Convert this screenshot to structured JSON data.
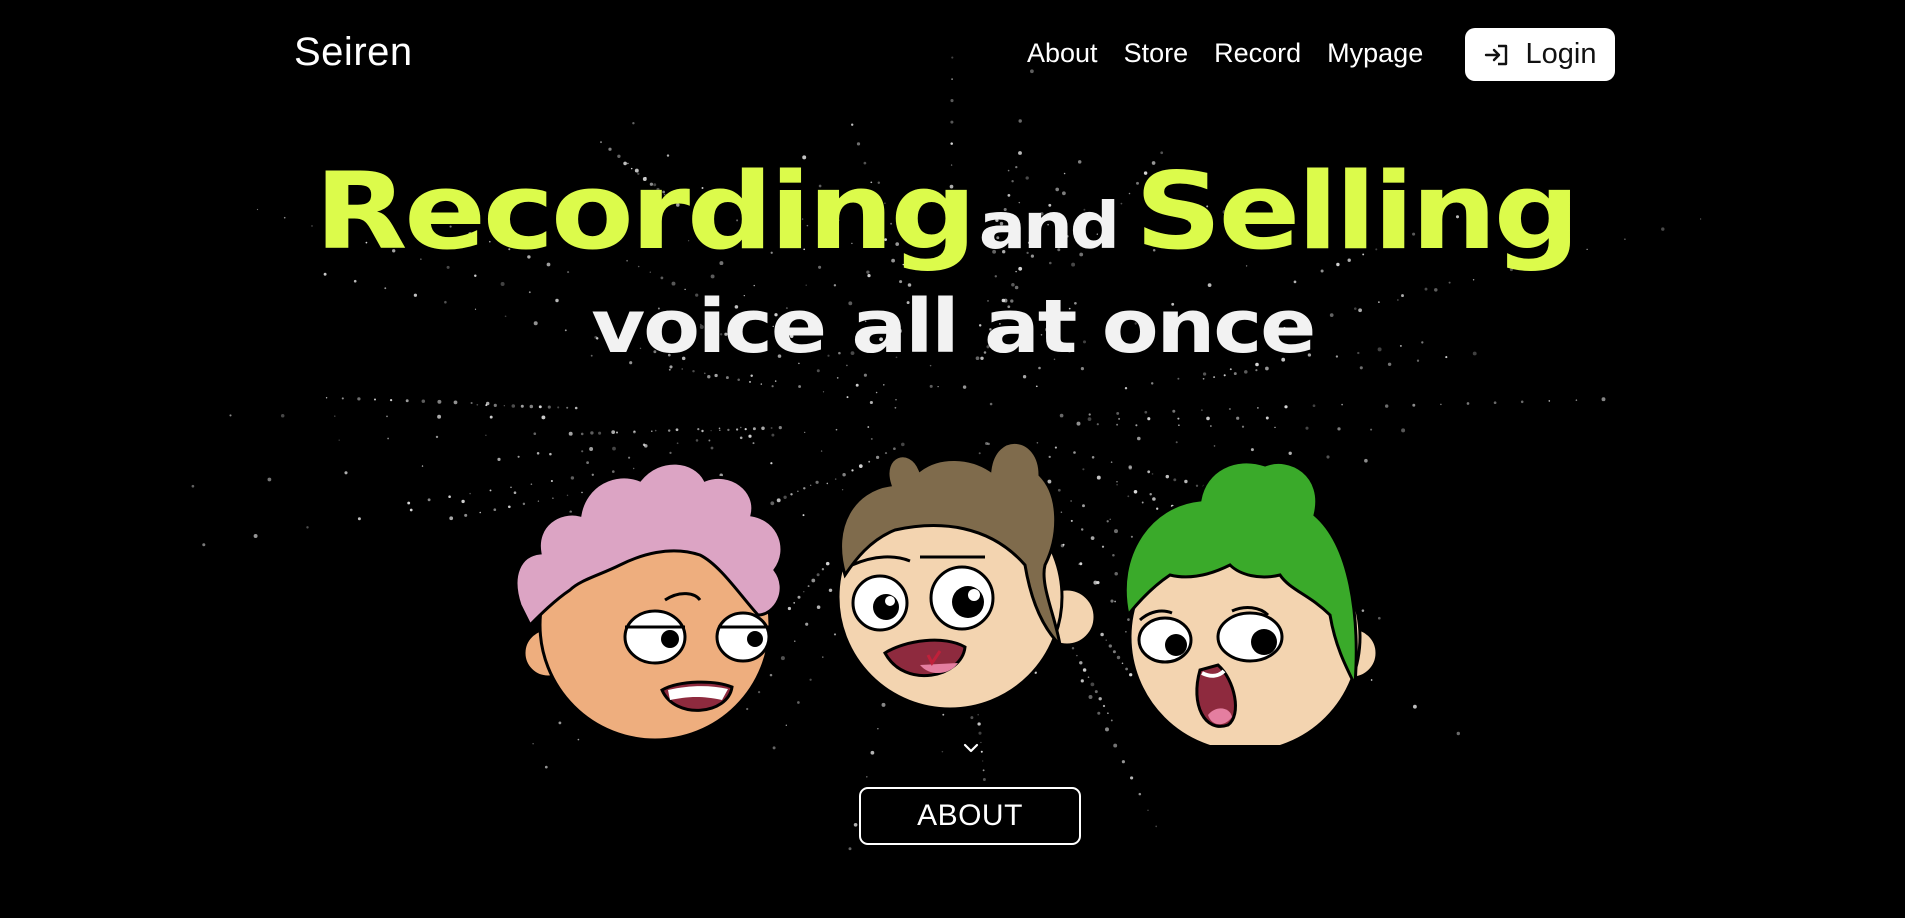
{
  "header": {
    "logo": "Seiren",
    "nav": [
      "About",
      "Store",
      "Record",
      "Mypage"
    ],
    "login_label": "Login"
  },
  "hero": {
    "line1": [
      "Recording",
      "and",
      "Selling"
    ],
    "line2": "voice all at once"
  },
  "cta": {
    "about_label": "ABOUT"
  },
  "colors": {
    "background": "#000000",
    "accent": "#dcfb4b",
    "text": "#f2f2f2",
    "pink_hair": "#dca4c4",
    "brown_hair": "#7f6b4c",
    "green_hair": "#3aaa2a",
    "skin_orange": "#eeae7e",
    "skin_light": "#f3d4b0"
  },
  "icons": {
    "login": "login-arrow-icon",
    "scroll": "chevron-down-icon"
  }
}
